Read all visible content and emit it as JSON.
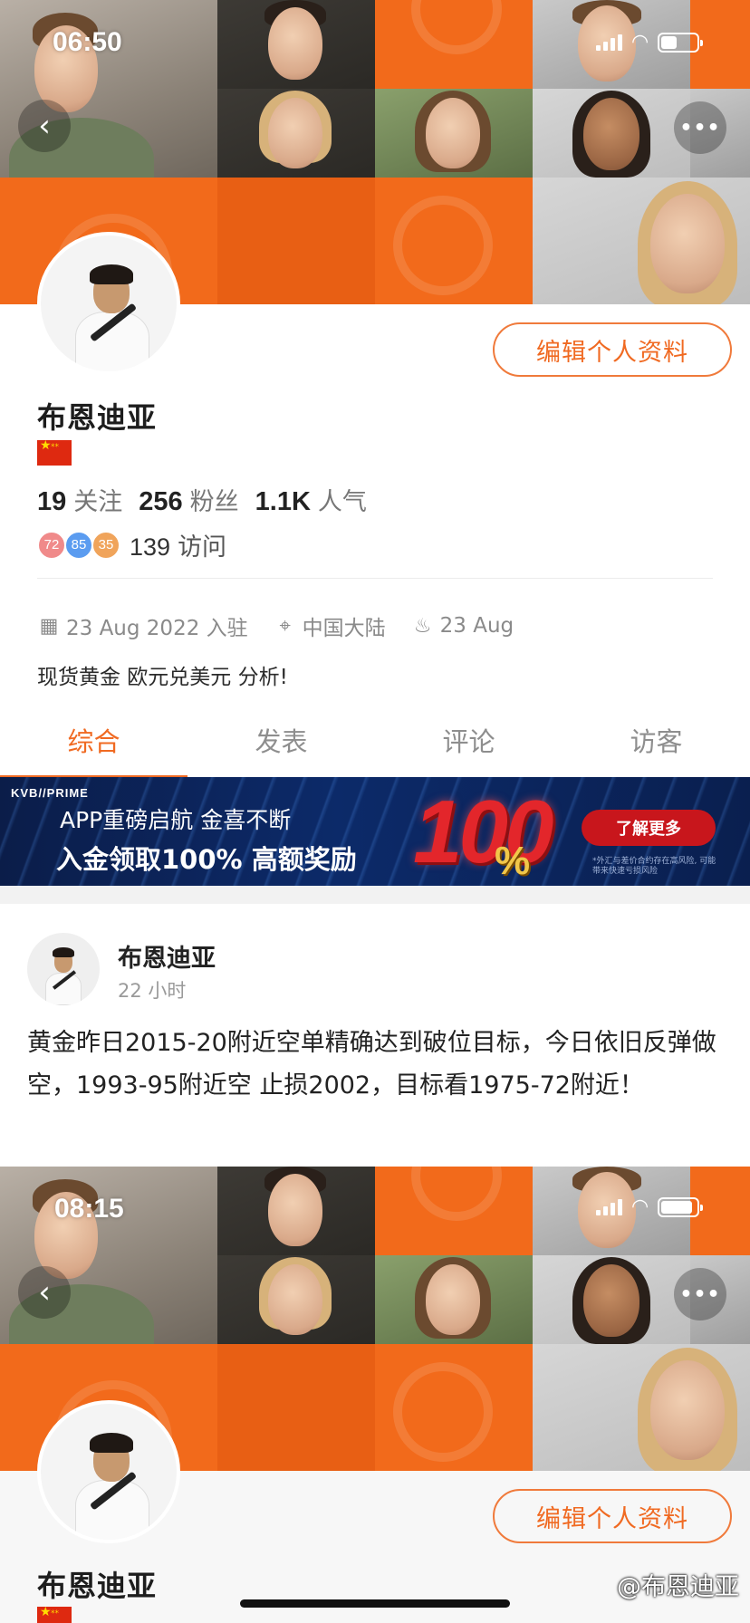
{
  "status_bar": {
    "time": "06:50"
  },
  "profile": {
    "username": "布恩迪亚",
    "edit_button": "编辑个人资料",
    "stats": {
      "following_count": "19",
      "following_label": "关注",
      "followers_count": "256",
      "followers_label": "粉丝",
      "popularity_count": "1.1K",
      "popularity_label": "人气"
    },
    "visitor_badges": [
      "72",
      "85",
      "35"
    ],
    "visitor_badge_colors": [
      "#f08a8a",
      "#5b9cf0",
      "#f0a45b"
    ],
    "visits_count": "139",
    "visits_label": "访问",
    "joined": "23 Aug 2022 入驻",
    "location": "中国大陆",
    "birthday": "23 Aug",
    "bio": "现货黄金 欧元兑美元 分析!"
  },
  "tabs": [
    "综合",
    "发表",
    "评论",
    "访客"
  ],
  "banner": {
    "brand": "KVB//PRIME",
    "line1": "APP重磅启航 金喜不断",
    "line2": "入金领取100% 高额奖励",
    "big_number": "100",
    "percent_sign": "%",
    "cta": "了解更多",
    "disclaimer": "*外汇与差价合约存在高风险, 可能带来快速亏损风险"
  },
  "post": {
    "author": "布恩迪亚",
    "time": "22 小时",
    "text": "黄金昨日2015-20附近空单精确达到破位目标，今日依旧反弹做空，1993-95附近空 止损2002，目标看1975-72附近！"
  },
  "second_screen": {
    "time": "08:15",
    "edit_button": "编辑个人资料",
    "username": "布恩迪亚"
  },
  "watermark": "@布恩迪亚",
  "colors": {
    "accent": "#f06a22",
    "orange_tile": "#f26a1b"
  }
}
